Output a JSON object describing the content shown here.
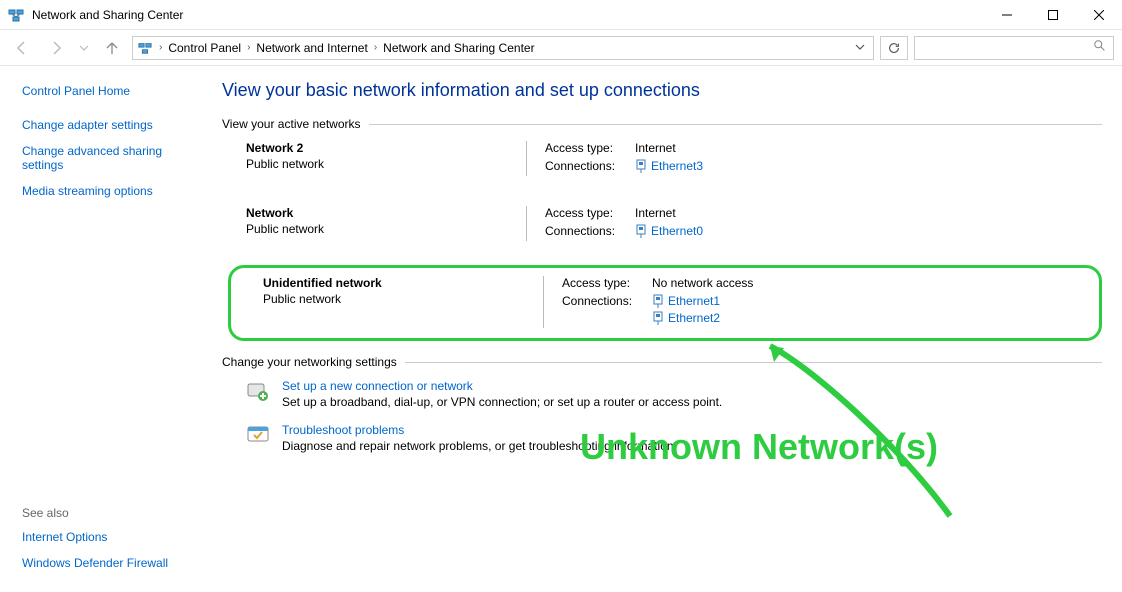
{
  "titlebar": {
    "title": "Network and Sharing Center"
  },
  "breadcrumb": {
    "items": [
      "Control Panel",
      "Network and Internet",
      "Network and Sharing Center"
    ]
  },
  "sidebar": {
    "home": "Control Panel Home",
    "links": {
      "adapter": "Change adapter settings",
      "advanced": "Change advanced sharing settings",
      "streaming": "Media streaming options"
    },
    "see_also_label": "See also",
    "see_also": {
      "internet_options": "Internet Options",
      "defender": "Windows Defender Firewall"
    }
  },
  "main": {
    "title": "View your basic network information and set up connections",
    "active_header": "View your active networks",
    "labels": {
      "access_type": "Access type:",
      "connections": "Connections:"
    },
    "networks": [
      {
        "name": "Network 2",
        "type": "Public network",
        "access": "Internet",
        "connections": [
          "Ethernet3"
        ]
      },
      {
        "name": "Network",
        "type": "Public network",
        "access": "Internet",
        "connections": [
          "Ethernet0"
        ]
      },
      {
        "name": "Unidentified network",
        "type": "Public network",
        "access": "No network access",
        "connections": [
          "Ethernet1",
          "Ethernet2"
        ]
      }
    ],
    "change_header": "Change your networking settings",
    "setup": {
      "title": "Set up a new connection or network",
      "desc": "Set up a broadband, dial-up, or VPN connection; or set up a router or access point."
    },
    "troubleshoot": {
      "title": "Troubleshoot problems",
      "desc": "Diagnose and repair network problems, or get troubleshooting information."
    }
  },
  "annotation": {
    "text": "Unknown Network(s)"
  }
}
